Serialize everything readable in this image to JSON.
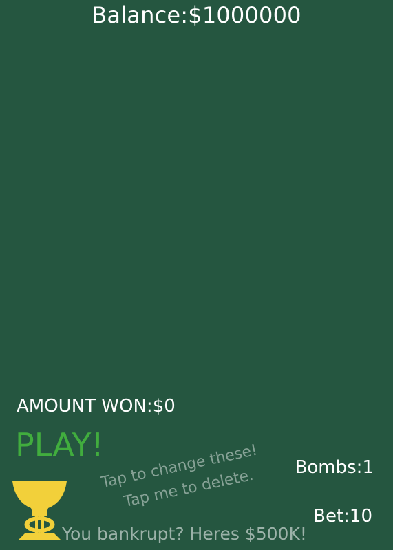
{
  "header": {
    "balance_text": "Balance:$1000000"
  },
  "status": {
    "amount_won_text": "AMOUNT WON:$0"
  },
  "controls": {
    "play_label": "PLAY!",
    "bombs_text": "Bombs:1",
    "bet_text": "Bet:10",
    "bankrupt_text": "You bankrupt? Heres $500K!"
  },
  "hints": {
    "change_text": "Tap to change these!",
    "delete_text": "Tap me to delete."
  },
  "icons": {
    "trophy": "trophy-icon"
  },
  "colors": {
    "background": "#255640",
    "play": "#41ad3e",
    "trophy": "#f2d03a"
  }
}
